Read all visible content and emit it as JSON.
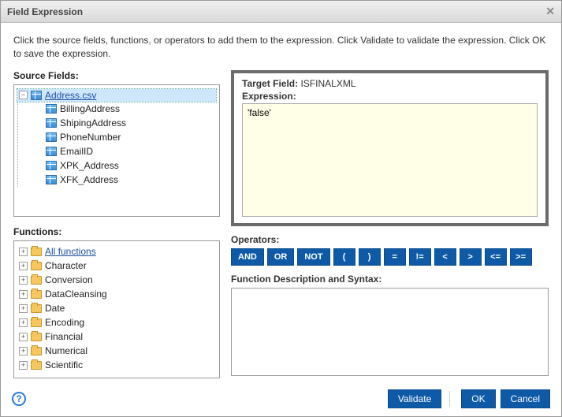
{
  "title": "Field Expression",
  "instructions": "Click the source fields, functions, or operators to add them to the expression. Click Validate to validate the expression. Click OK to save the expression.",
  "labels": {
    "source_fields": "Source Fields:",
    "functions": "Functions:",
    "target_field_label": "Target Field:",
    "expression": "Expression:",
    "operators": "Operators:",
    "desc": "Function Description and Syntax:"
  },
  "target_field": "ISFINALXML",
  "expression_value": "'false'",
  "source_tree": {
    "root": "Address.csv",
    "children": [
      "BillingAddress",
      "ShipingAddress",
      "PhoneNumber",
      "EmailID",
      "XPK_Address",
      "XFK_Address"
    ]
  },
  "functions": [
    "All functions",
    "Character",
    "Conversion",
    "DataCleansing",
    "Date",
    "Encoding",
    "Financial",
    "Numerical",
    "Scientific"
  ],
  "operators": [
    "AND",
    "OR",
    "NOT",
    "(",
    ")",
    "=",
    "!=",
    "<",
    ">",
    "<=",
    ">="
  ],
  "buttons": {
    "validate": "Validate",
    "ok": "OK",
    "cancel": "Cancel"
  }
}
